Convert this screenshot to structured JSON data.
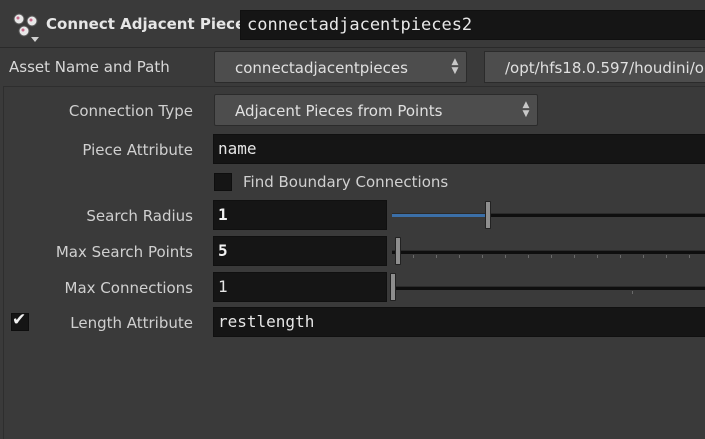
{
  "header": {
    "node_type_label": "Connect Adjacent Pieces",
    "node_name": "connectadjacentpieces2",
    "icon": "connect-pieces-icon"
  },
  "asset": {
    "label": "Asset Name and Path",
    "name": "connectadjacentpieces",
    "path": "/opt/hfs18.0.597/houdini/o"
  },
  "params": {
    "connection_type": {
      "label": "Connection Type",
      "value": "Adjacent Pieces from Points"
    },
    "piece_attribute": {
      "label": "Piece Attribute",
      "value": "name"
    },
    "find_boundary": {
      "label": "Find Boundary Connections",
      "checked": false
    },
    "search_radius": {
      "label": "Search Radius",
      "value": "1",
      "slider_fraction": 0.3
    },
    "max_search_points": {
      "label": "Max Search Points",
      "value": "5",
      "slider_fraction": 0.0
    },
    "max_connections": {
      "label": "Max Connections",
      "value": "1",
      "slider_fraction": 0.0
    },
    "length_attribute": {
      "label": "Length Attribute",
      "value": "restlength",
      "enabled": true
    }
  },
  "colors": {
    "background": "#3a3a3a",
    "field": "#151515",
    "slider_fill": "#3b6fa8"
  }
}
